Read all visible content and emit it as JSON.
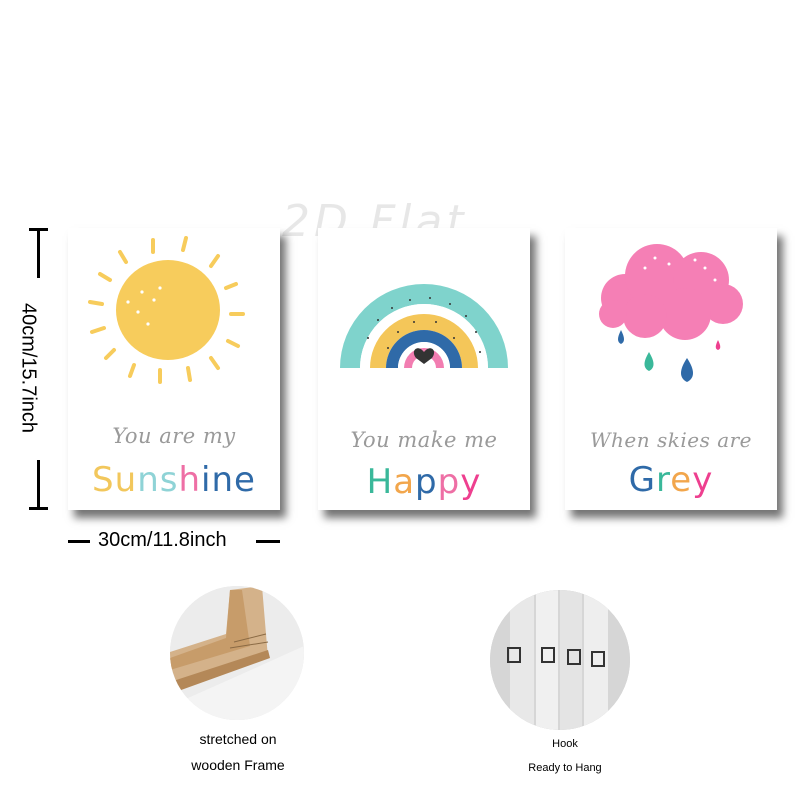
{
  "watermark": "2D Flat",
  "dimensions": {
    "height_label": "40cm/15.7inch",
    "width_label": "30cm/11.8inch"
  },
  "panels": [
    {
      "script_text": "You are my",
      "big_letters": [
        "S",
        "u",
        "n",
        "s",
        "h",
        "i",
        "n",
        "e"
      ],
      "big_colors": [
        "#f2c75c",
        "#f2c75c",
        "#8fd3d6",
        "#8fd3d6",
        "#ee6fa5",
        "#2f6aa8",
        "#2f6aa8",
        "#2f6aa8"
      ]
    },
    {
      "script_text": "You make me",
      "big_letters": [
        "H",
        "a",
        "p",
        "p",
        "y"
      ],
      "big_colors": [
        "#3ab89a",
        "#f2a64c",
        "#2f6aa8",
        "#ee6fa5",
        "#ee3f8f"
      ]
    },
    {
      "script_text": "When skies are",
      "big_letters": [
        "G",
        "r",
        "e",
        "y"
      ],
      "big_colors": [
        "#2f6aa8",
        "#3ab89a",
        "#f2a64c",
        "#ee3f8f"
      ]
    }
  ],
  "features": [
    {
      "line1": "stretched on",
      "line2": "wooden Frame"
    },
    {
      "line1": "Hook",
      "line2": "Ready to Hang"
    }
  ],
  "colors": {
    "sun": "#f7cc5c",
    "cloud": "#f57fb5",
    "rainbow_teal": "#7fd3cc",
    "rainbow_yellow": "#f4c659",
    "rainbow_blue": "#2f6aa8",
    "rainbow_pink": "#f27db1",
    "script_gray": "#9a9a9a"
  }
}
